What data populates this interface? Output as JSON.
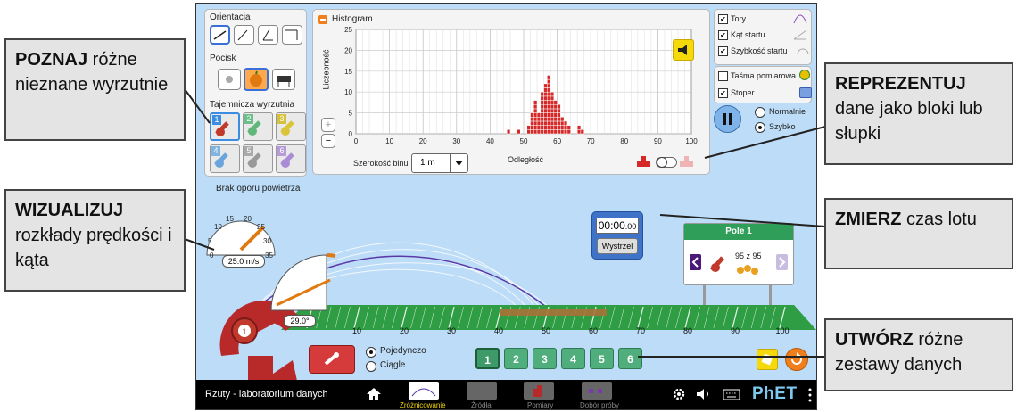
{
  "orientation": {
    "title": "Orientacja"
  },
  "projectile": {
    "title": "Pocisk"
  },
  "mystery": {
    "title": "Tajemnicza wyrzutnia",
    "items": [
      "1",
      "2",
      "3",
      "4",
      "5",
      "6"
    ]
  },
  "air": {
    "label": "Brak oporu powietrza"
  },
  "histogram": {
    "title": "Histogram",
    "ylabel": "Liczebność",
    "xlabel": "Odległość",
    "yticks": [
      "0",
      "5",
      "10",
      "15",
      "20",
      "25"
    ],
    "xticks": [
      "0",
      "10",
      "20",
      "30",
      "40",
      "50",
      "60",
      "70",
      "80",
      "90",
      "100"
    ],
    "bin_label": "Szerokość binu",
    "bin_value": "1 m",
    "zoom_in": "+",
    "zoom_out": "−"
  },
  "chart_data": {
    "type": "bar",
    "xlabel": "Odległość",
    "ylabel": "Liczebność",
    "xlim": [
      0,
      100
    ],
    "ylim": [
      0,
      25
    ],
    "bins": [
      {
        "x": 45,
        "count": 1
      },
      {
        "x": 48,
        "count": 1
      },
      {
        "x": 51,
        "count": 2
      },
      {
        "x": 52,
        "count": 5
      },
      {
        "x": 53,
        "count": 8
      },
      {
        "x": 54,
        "count": 5
      },
      {
        "x": 55,
        "count": 10
      },
      {
        "x": 56,
        "count": 12
      },
      {
        "x": 57,
        "count": 14
      },
      {
        "x": 58,
        "count": 10
      },
      {
        "x": 59,
        "count": 8
      },
      {
        "x": 60,
        "count": 7
      },
      {
        "x": 61,
        "count": 4
      },
      {
        "x": 62,
        "count": 3
      },
      {
        "x": 63,
        "count": 2
      },
      {
        "x": 66,
        "count": 2
      },
      {
        "x": 67,
        "count": 1
      }
    ]
  },
  "checks": {
    "tory": "Tory",
    "kat": "Kąt startu",
    "szybkosc": "Szybkość startu",
    "tasma": "Taśma pomiarowa",
    "stoper": "Stoper"
  },
  "speed": {
    "normal": "Normalnie",
    "fast": "Szybko"
  },
  "stopwatch": {
    "time": "00:00",
    "fraction": ".00",
    "button": "Wystrzel"
  },
  "field": {
    "title": "Pole 1",
    "count": "95 z 95"
  },
  "gauge_speed": {
    "ticks": [
      "0",
      "5",
      "10",
      "15",
      "20",
      "25",
      "30",
      "35"
    ],
    "value": "25.0 m/s"
  },
  "gauge_angle": {
    "value": "29.0°"
  },
  "ruler": [
    "10",
    "20",
    "30",
    "40",
    "50",
    "60",
    "70",
    "80",
    "90",
    "100"
  ],
  "launch": {
    "single": "Pojedynczo",
    "continuous": "Ciągle"
  },
  "datasets": [
    "1",
    "2",
    "3",
    "4",
    "5",
    "6"
  ],
  "nav": {
    "title": "Rzuty - laboratorium danych",
    "tabs": [
      "Zróżnicowanie",
      "Źródła",
      "Pomiary",
      "Dobór próby"
    ],
    "brand": "PhET"
  },
  "callouts": {
    "poznaj_bold": "POZNAJ",
    "poznaj_rest": " różne nieznane wyrzutnie",
    "wizualizuj_bold": "WIZUALIZUJ",
    "wizualizuj_rest": " rozkłady prędkości i kąta",
    "reprezentuj_bold": "REPREZENTUJ",
    "reprezentuj_rest": " dane jako bloki lub słupki",
    "zmierz_bold": "ZMIERZ",
    "zmierz_rest": " czas lotu",
    "utworz_bold": "UTWÓRZ",
    "utworz_rest": " różne zestawy danych"
  },
  "colors": {
    "accent": "#f07f1b",
    "sky": "#bcdcf7",
    "field": "#2e9d44",
    "hist": "#d62828",
    "dataset": "#4fae7c"
  }
}
